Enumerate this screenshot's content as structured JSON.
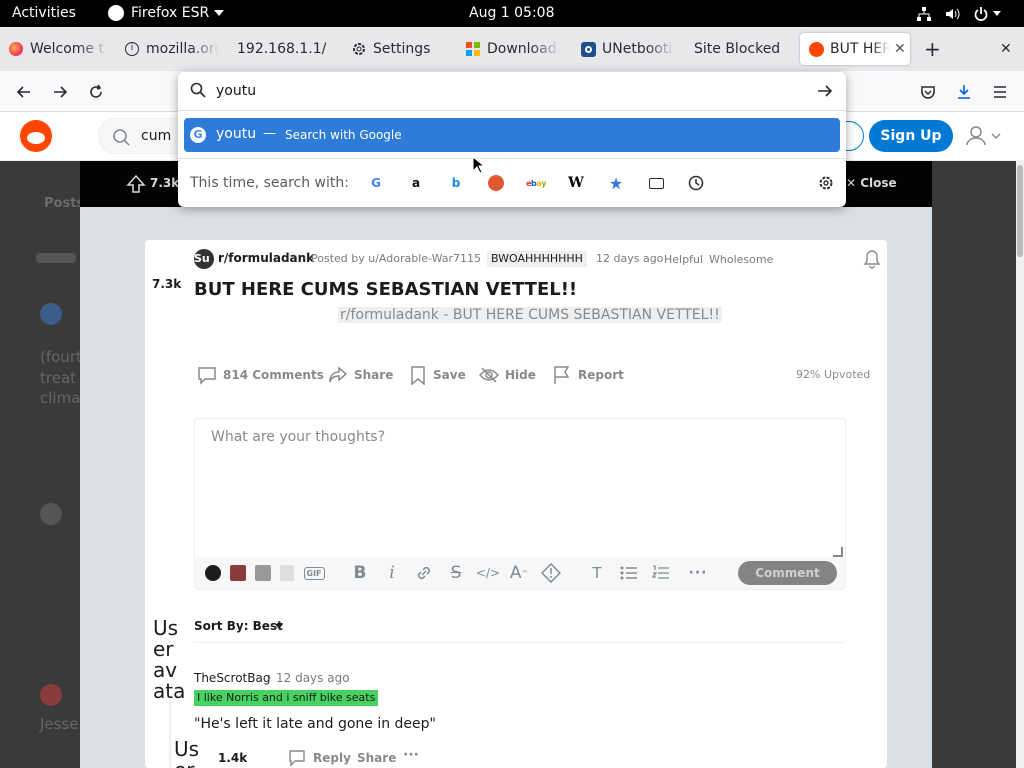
{
  "system_bar": {
    "activities": "Activities",
    "app_name": "Firefox ESR",
    "clock": "Aug 1  05:08"
  },
  "tabs": [
    {
      "label": "Welcome t",
      "icon": "firefox-icon"
    },
    {
      "label": "mozilla.org",
      "icon": "info-icon"
    },
    {
      "label": "192.168.1.1/",
      "icon": ""
    },
    {
      "label": "Settings",
      "icon": "gear-icon"
    },
    {
      "label": "Download",
      "icon": "microsoft-icon"
    },
    {
      "label": "UNetbooti",
      "icon": "unetbootin-icon"
    },
    {
      "label": "Site Blocked",
      "icon": ""
    },
    {
      "label": "BUT HER",
      "icon": "reddit-icon",
      "active": true
    }
  ],
  "urlbar": {
    "value": "youtu",
    "suggestion_text": "youtu",
    "suggestion_sep": "—",
    "suggestion_action": "Search with Google",
    "search_with_label": "This time, search with:"
  },
  "reddit_header": {
    "search_value": "cum",
    "signup": "Sign Up"
  },
  "modal_bar": {
    "votes": "7.3k",
    "close": "Close"
  },
  "post": {
    "votes": "7.3k",
    "subreddit": "r/formuladank",
    "posted_by": "Posted by u/Adorable-War7115",
    "flair": "BWOAHHHHHHH",
    "age": "12 days ago",
    "award1": "Helpful",
    "award2": "Wholesome",
    "title": "BUT HERE CUMS SEBASTIAN VETTEL!!",
    "image_alt": "r/formuladank - BUT HERE CUMS SEBASTIAN VETTEL!!",
    "sub_icon_alt": "Subreddit Icon",
    "comments": "814 Comments",
    "share": "Share",
    "save": "Save",
    "hide": "Hide",
    "report": "Report",
    "upvoted": "92% Upvoted"
  },
  "comment_box": {
    "placeholder": "What are your thoughts?",
    "submit": "Comment"
  },
  "sort": {
    "label": "Sort By: Best"
  },
  "comments": [
    {
      "avatar_alt": "User avatar",
      "author": "TheScrotBag",
      "age": "12 days ago",
      "flair": "I like Norris and i sniff bike seats",
      "text": "\"He's left it late and gone in deep\"",
      "votes": "1.4k",
      "reply": "Reply",
      "share": "Share"
    }
  ],
  "nested_avatar_alt": "User",
  "background_feed": {
    "posts_label": "Posts",
    "text_lines": [
      "(fourth",
      "treat",
      "clima"
    ],
    "bottom_text": "Jesse"
  },
  "colors": {
    "reddit_orange": "#ff4500",
    "reddit_blue": "#0079d3",
    "selection_blue": "#2f7bd8",
    "flair_green": "#46d160"
  }
}
